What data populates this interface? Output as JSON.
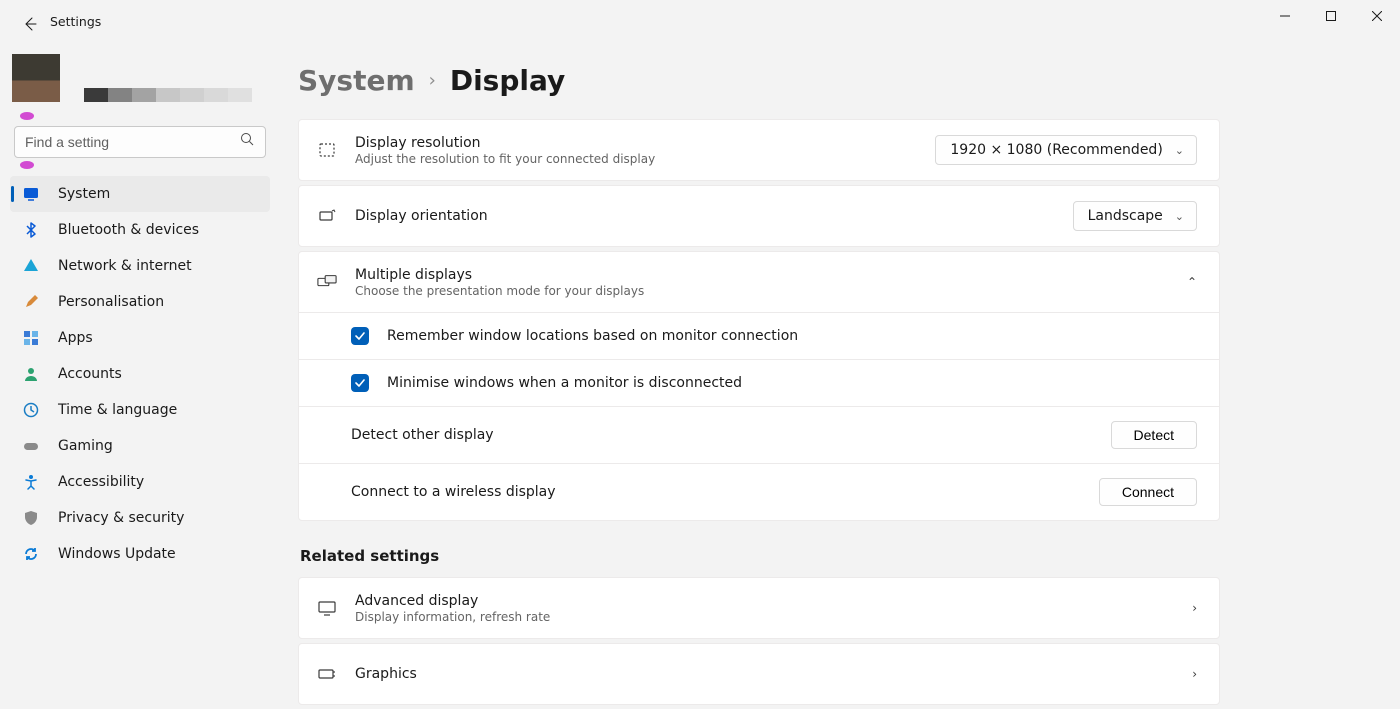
{
  "window": {
    "title": "Settings"
  },
  "sidebar": {
    "search_placeholder": "Find a setting",
    "items": [
      {
        "label": "System",
        "icon": "monitor",
        "active": true
      },
      {
        "label": "Bluetooth & devices",
        "icon": "bluetooth"
      },
      {
        "label": "Network & internet",
        "icon": "wifi"
      },
      {
        "label": "Personalisation",
        "icon": "brush"
      },
      {
        "label": "Apps",
        "icon": "apps"
      },
      {
        "label": "Accounts",
        "icon": "person"
      },
      {
        "label": "Time & language",
        "icon": "clock"
      },
      {
        "label": "Gaming",
        "icon": "gaming"
      },
      {
        "label": "Accessibility",
        "icon": "access"
      },
      {
        "label": "Privacy & security",
        "icon": "shield"
      },
      {
        "label": "Windows Update",
        "icon": "update"
      }
    ]
  },
  "breadcrumb": {
    "parent": "System",
    "current": "Display"
  },
  "settings": {
    "resolution": {
      "title": "Display resolution",
      "desc": "Adjust the resolution to fit your connected display",
      "value": "1920 × 1080 (Recommended)"
    },
    "orientation": {
      "title": "Display orientation",
      "value": "Landscape"
    },
    "multidisplays": {
      "title": "Multiple displays",
      "desc": "Choose the presentation mode for your displays",
      "opts": [
        {
          "label": "Remember window locations based on monitor connection",
          "checked": true
        },
        {
          "label": "Minimise windows when a monitor is disconnected",
          "checked": true
        }
      ],
      "detect": {
        "label": "Detect other display",
        "button": "Detect"
      },
      "wireless": {
        "label": "Connect to a wireless display",
        "button": "Connect"
      }
    }
  },
  "related": {
    "heading": "Related settings",
    "items": [
      {
        "title": "Advanced display",
        "desc": "Display information, refresh rate"
      },
      {
        "title": "Graphics",
        "desc": ""
      }
    ]
  }
}
